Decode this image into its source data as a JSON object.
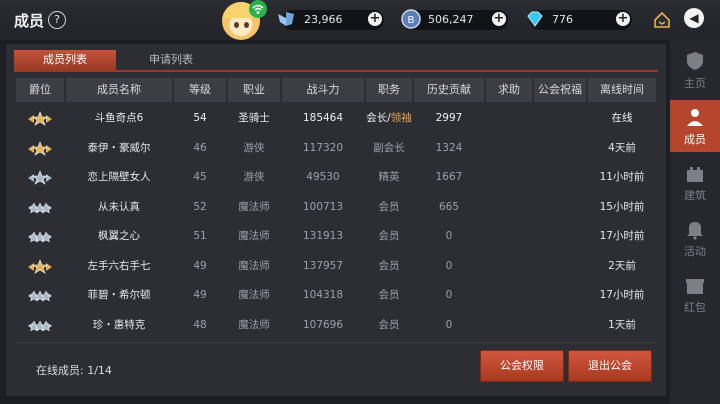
{
  "header": {
    "title": "成员",
    "help_glyph": "?"
  },
  "resources": [
    {
      "icon": "winged-shield-icon",
      "value": "23,966"
    },
    {
      "icon": "coin-icon",
      "value": "506,247"
    },
    {
      "icon": "diamond-icon",
      "value": "776"
    }
  ],
  "tabs": {
    "members": "成员列表",
    "applications": "申请列表"
  },
  "columns": [
    "爵位",
    "成员名称",
    "等级",
    "职业",
    "战斗力",
    "职务",
    "历史贡献",
    "求助",
    "公会祝福",
    "离线时间"
  ],
  "members": [
    {
      "rank": "gold",
      "name": "斗鱼奇点6",
      "level": "54",
      "class": "圣骑士",
      "power": "185464",
      "role_main": "会长/",
      "role_extra": "领袖",
      "contrib": "2997",
      "help": "",
      "bless": "",
      "offline": "在线",
      "online": true
    },
    {
      "rank": "gold",
      "name": "泰伊・豪威尔",
      "level": "46",
      "class": "游侠",
      "power": "117320",
      "role_main": "副会长",
      "role_extra": "",
      "contrib": "1324",
      "help": "",
      "bless": "",
      "offline": "4天前",
      "online": false
    },
    {
      "rank": "silver",
      "name": "恋上隔壁女人",
      "level": "45",
      "class": "游侠",
      "power": "49530",
      "role_main": "精英",
      "role_extra": "",
      "contrib": "1667",
      "help": "",
      "bless": "",
      "offline": "11小时前",
      "online": false
    },
    {
      "rank": "silver3",
      "name": "从未认真",
      "level": "52",
      "class": "魔法师",
      "power": "100713",
      "role_main": "会员",
      "role_extra": "",
      "contrib": "665",
      "help": "",
      "bless": "",
      "offline": "15小时前",
      "online": false
    },
    {
      "rank": "silver3",
      "name": "枫翼之心",
      "level": "51",
      "class": "魔法师",
      "power": "131913",
      "role_main": "会员",
      "role_extra": "",
      "contrib": "0",
      "help": "",
      "bless": "",
      "offline": "17小时前",
      "online": false
    },
    {
      "rank": "gold",
      "name": "左手六右手七",
      "level": "49",
      "class": "魔法师",
      "power": "137957",
      "role_main": "会员",
      "role_extra": "",
      "contrib": "0",
      "help": "",
      "bless": "",
      "offline": "2天前",
      "online": false
    },
    {
      "rank": "silver3",
      "name": "菲碧・希尔顿",
      "level": "49",
      "class": "魔法师",
      "power": "104318",
      "role_main": "会员",
      "role_extra": "",
      "contrib": "0",
      "help": "",
      "bless": "",
      "offline": "17小时前",
      "online": false
    },
    {
      "rank": "silver3",
      "name": "珍・惠特克",
      "level": "48",
      "class": "魔法师",
      "power": "107696",
      "role_main": "会员",
      "role_extra": "",
      "contrib": "0",
      "help": "",
      "bless": "",
      "offline": "1天前",
      "online": false
    }
  ],
  "footer": {
    "online_label": "在线成员: 1/14",
    "perm_button": "公会权限",
    "quit_button": "退出公会"
  },
  "sidenav": [
    {
      "icon": "shield-icon",
      "label": "主页",
      "active": false
    },
    {
      "icon": "member-icon",
      "label": "成员",
      "active": true
    },
    {
      "icon": "castle-icon",
      "label": "建筑",
      "active": false
    },
    {
      "icon": "bell-icon",
      "label": "活动",
      "active": false
    },
    {
      "icon": "gift-icon",
      "label": "红包",
      "active": false
    }
  ],
  "colors": {
    "accent": "#b6452e",
    "online": "#45d66a",
    "leader_tag": "#e1a74a"
  }
}
